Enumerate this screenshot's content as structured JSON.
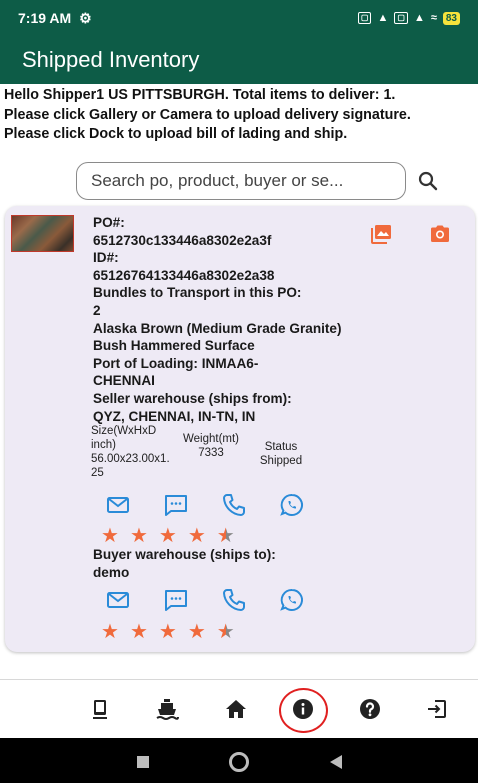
{
  "status_bar": {
    "time": "7:19 AM",
    "battery": "83"
  },
  "app_bar": {
    "title": "Shipped Inventory"
  },
  "intro": {
    "line1": "Hello Shipper1 US PITTSBURGH. Total items to deliver: 1.",
    "line2": "Please click Gallery or Camera to upload delivery signature.",
    "line3": "Please click Dock to upload bill of lading and ship."
  },
  "search": {
    "placeholder": "Search po, product, buyer or se..."
  },
  "item": {
    "po_label": "PO#:",
    "po_value": "6512730c133446a8302e2a3f",
    "id_label": "ID#:",
    "id_value": "65126764133446a8302e2a38",
    "bundles_label": "Bundles to Transport in this PO:",
    "bundles_value": "2",
    "product": "Alaska Brown (Medium Grade Granite) Bush Hammered Surface",
    "port": "Port of Loading: INMAA6-CHENNAI",
    "seller_label": "Seller warehouse (ships from):",
    "seller_value": "QYZ, CHENNAI, IN-TN, IN",
    "size_label": "Size(WxHxD inch)",
    "size_value": "56.00x23.00x1.25",
    "weight_label": "Weight(mt)",
    "weight_value": "7333",
    "status_label": "Status",
    "status_value": "Shipped",
    "seller_rating": 4.5,
    "buyer_label": "Buyer warehouse (ships to):",
    "buyer_value": "demo",
    "buyer_rating": 4.5,
    "colors": {
      "accent": "#f06a3c",
      "contact": "#2a8bd8"
    }
  },
  "colors": {
    "brand": "#0d5c47"
  },
  "nav": [
    "device-icon",
    "ship-icon",
    "home-icon",
    "info-icon",
    "help-icon",
    "exit-icon"
  ]
}
